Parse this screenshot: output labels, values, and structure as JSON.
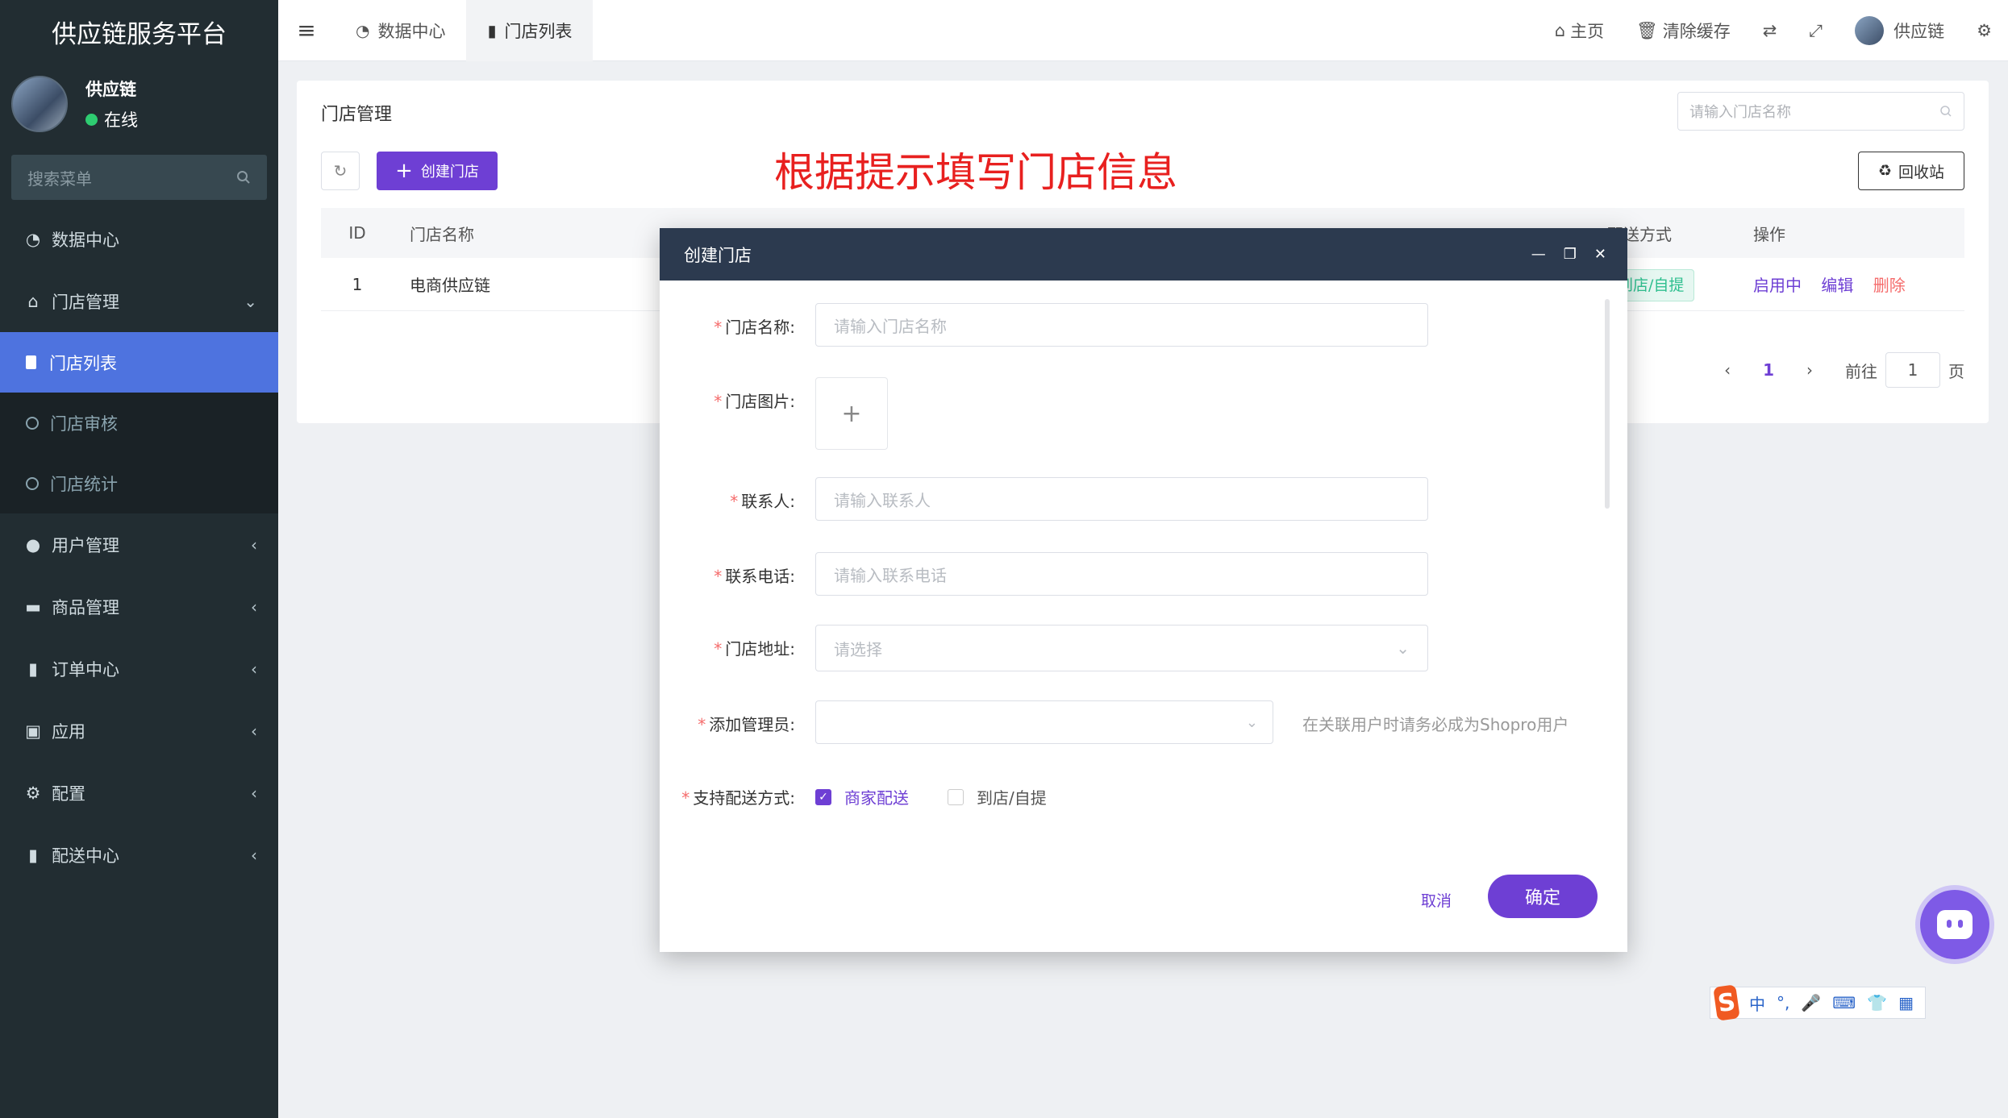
{
  "sidebar": {
    "brand": "供应链服务平台",
    "user_name": "供应链",
    "user_status": "在线",
    "search_placeholder": "搜索菜单",
    "items": [
      {
        "label": "数据中心",
        "icon": "dashboard-icon"
      },
      {
        "label": "门店管理",
        "icon": "bank-icon"
      },
      {
        "label": "用户管理",
        "icon": "user-icon"
      },
      {
        "label": "商品管理",
        "icon": "box-icon"
      },
      {
        "label": "订单中心",
        "icon": "file-icon"
      },
      {
        "label": "应用",
        "icon": "briefcase-icon"
      },
      {
        "label": "配置",
        "icon": "gears-icon"
      },
      {
        "label": "配送中心",
        "icon": "file-icon"
      }
    ],
    "sub_items": [
      {
        "label": "门店列表",
        "active": true
      },
      {
        "label": "门店审核",
        "active": false
      },
      {
        "label": "门店统计",
        "active": false
      }
    ]
  },
  "topbar": {
    "tabs": [
      {
        "label": "数据中心",
        "active": false
      },
      {
        "label": "门店列表",
        "active": true
      }
    ],
    "home": "主页",
    "clear_cache": "清除缓存",
    "user": "供应链"
  },
  "panel": {
    "title": "门店管理",
    "search_placeholder": "请输入门店名称",
    "create_label": "创建门店",
    "hint": "根据提示填写门店信息",
    "recycle_label": "回收站",
    "columns": {
      "id": "ID",
      "name": "门店名称",
      "delivery": "配送方式",
      "ops": "操作"
    },
    "row": {
      "id": "1",
      "name": "电商供应链",
      "delivery": "到店/自提",
      "status": "启用中",
      "edit": "编辑",
      "delete": "删除"
    },
    "pager": {
      "current": "1",
      "goto": "前往",
      "page_input": "1",
      "page_suffix": "页"
    }
  },
  "dialog": {
    "title": "创建门店",
    "fields": {
      "name_label": "门店名称:",
      "name_placeholder": "请输入门店名称",
      "image_label": "门店图片:",
      "contact_label": "联系人:",
      "contact_placeholder": "请输入联系人",
      "phone_label": "联系电话:",
      "phone_placeholder": "请输入联系电话",
      "address_label": "门店地址:",
      "address_placeholder": "请选择",
      "admin_label": "添加管理员:",
      "admin_help": "在关联用户时请务必成为Shopro用户",
      "delivery_label": "支持配送方式:",
      "delivery_opt1": "商家配送",
      "delivery_opt2": "到店/自提"
    },
    "cancel": "取消",
    "confirm": "确定"
  },
  "ime": {
    "lang": "中"
  },
  "colors": {
    "primary": "#6e3fd4",
    "sidebar": "#222d32",
    "active_menu": "#4e73df",
    "hint": "#e8201f"
  }
}
